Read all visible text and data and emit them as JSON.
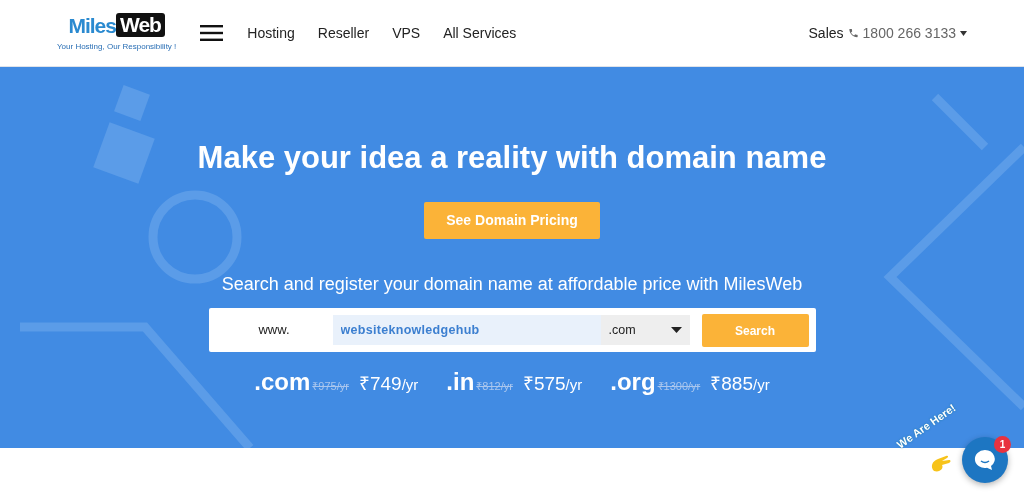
{
  "header": {
    "logo": {
      "part1": "Miles",
      "part2": "Web",
      "tagline": "Your Hosting, Our Responsibility !"
    },
    "nav": [
      "Hosting",
      "Reseller",
      "VPS",
      "All Services"
    ],
    "sales": {
      "label": "Sales",
      "phone": "1800 266 3133"
    }
  },
  "hero": {
    "title": "Make your idea a reality with domain name",
    "cta": "See Domain Pricing",
    "subtitle": "Search and register your domain name at affordable price with MilesWeb",
    "search": {
      "prefix": "www.",
      "value": "websiteknowledgehub",
      "tld": ".com",
      "button": "Search"
    },
    "prices": [
      {
        "tld": ".com",
        "old": "₹975/yr",
        "price": "₹749",
        "unit": "/yr"
      },
      {
        "tld": ".in",
        "old": "₹812/yr",
        "price": "₹575",
        "unit": "/yr"
      },
      {
        "tld": ".org",
        "old": "₹1300/yr",
        "price": "₹885",
        "unit": "/yr"
      }
    ]
  },
  "chat": {
    "greeting": "We Are Here!",
    "badge": "1"
  }
}
